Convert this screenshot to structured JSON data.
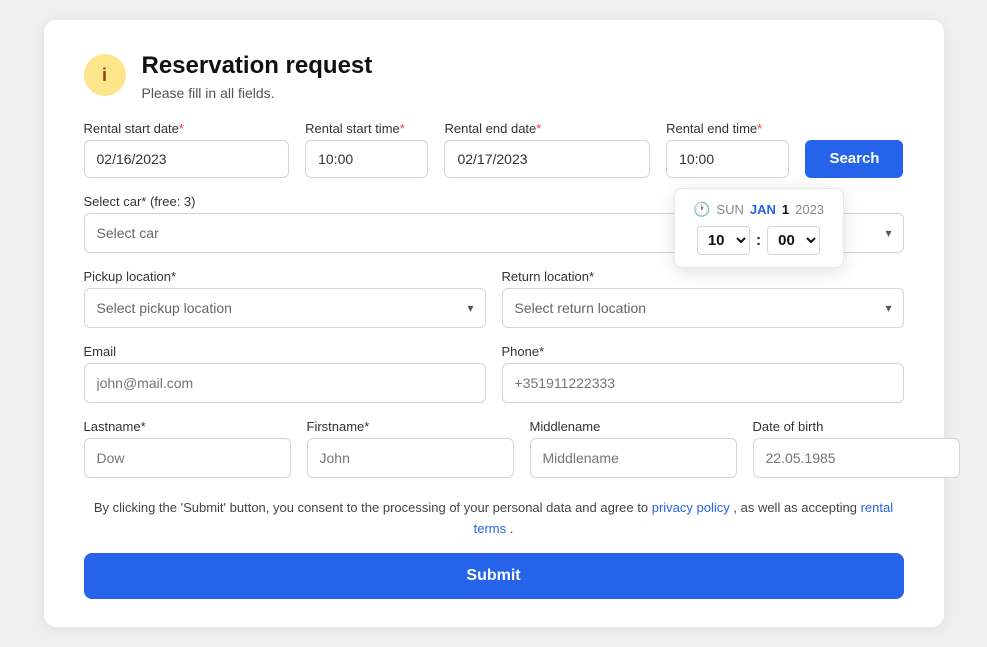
{
  "header": {
    "icon_label": "i",
    "title": "Reservation request",
    "subtitle": "Please fill in all fields."
  },
  "form": {
    "rental_start_date_label": "Rental start date",
    "rental_start_date_value": "02/16/2023",
    "rental_start_time_label": "Rental start time",
    "rental_start_time_value": "10:00",
    "rental_end_date_label": "Rental end date",
    "rental_end_date_value": "02/17/2023",
    "rental_end_time_label": "Rental end time",
    "rental_end_time_value": "10:00",
    "search_button_label": "Search",
    "select_car_label": "Select car* (free: 3)",
    "select_car_placeholder": "Select car",
    "time_picker_day": "SUN",
    "time_picker_month": "JAN",
    "time_picker_day_num": "1",
    "time_picker_year": "2023",
    "time_picker_hour": "10",
    "time_picker_minute": "00",
    "pickup_location_label": "Pickup location",
    "pickup_location_placeholder": "Select pickup location",
    "return_location_label": "Return location",
    "return_location_placeholder": "Select return location",
    "email_label": "Email",
    "email_placeholder": "john@mail.com",
    "phone_label": "Phone",
    "phone_placeholder": "+351911222333",
    "lastname_label": "Lastname",
    "lastname_placeholder": "Dow",
    "firstname_label": "Firstname",
    "firstname_placeholder": "John",
    "middlename_label": "Middlename",
    "middlename_placeholder": "Middlename",
    "dob_label": "Date of birth",
    "dob_placeholder": "22.05.1985"
  },
  "consent": {
    "text_before": "By clicking the 'Submit' button, you consent to the processing of your personal data and agree to",
    "privacy_link": "privacy policy",
    "text_middle": ", as well as accepting",
    "rental_link": "rental terms",
    "text_end": "."
  },
  "submit": {
    "label": "Submit"
  }
}
